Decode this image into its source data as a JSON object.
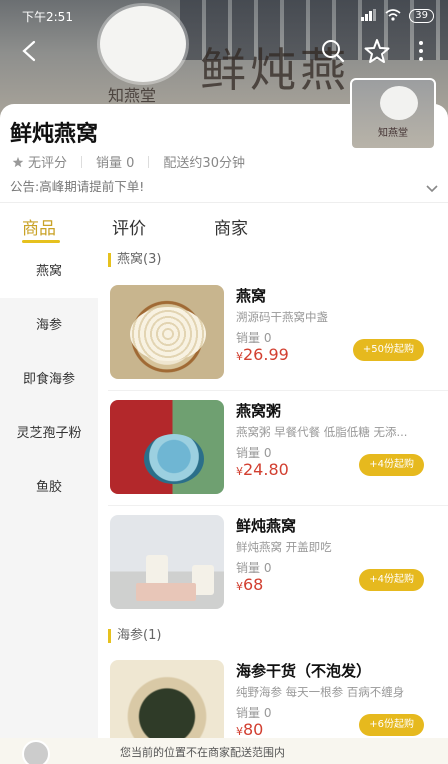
{
  "status_bar": {
    "time": "下午2:51",
    "battery": "39"
  },
  "shop": {
    "name": "鲜炖燕窝",
    "sign_text": "鲜炖燕",
    "sign_small": "知燕堂",
    "thumb_text": "知燕堂",
    "rating": "无评分",
    "sales": "销量 0",
    "delivery": "配送约30分钟",
    "notice": "公告:高峰期请提前下单!"
  },
  "tabs": [
    {
      "label": "商品",
      "active": true
    },
    {
      "label": "评价",
      "active": false
    },
    {
      "label": "商家",
      "active": false
    }
  ],
  "sidebar": [
    {
      "label": "燕窝",
      "active": true
    },
    {
      "label": "海参",
      "active": false
    },
    {
      "label": "即食海参",
      "active": false
    },
    {
      "label": "灵芝孢子粉",
      "active": false
    },
    {
      "label": "鱼胶",
      "active": false
    }
  ],
  "sections": [
    {
      "title": "燕窝(3)",
      "items": [
        {
          "name": "燕窝",
          "desc": "溯源码干燕窝中盏",
          "sales": "销量 0",
          "price": "26.99",
          "button": "+50份起购"
        },
        {
          "name": "燕窝粥",
          "desc": "燕窝粥 早餐代餐 低脂低糖 无添...",
          "sales": "销量 0",
          "price": "24.80",
          "button": "+4份起购"
        },
        {
          "name": "鲜炖燕窝",
          "desc": "鲜炖燕窝 开盖即吃",
          "sales": "销量 0",
          "price": "68",
          "button": "+4份起购"
        }
      ]
    },
    {
      "title": "海参(1)",
      "items": [
        {
          "name": "海参干货（不泡发）",
          "desc": "纯野海参 每天一根参 百病不缠身",
          "sales": "销量 0",
          "price": "80",
          "button": "+6份起购"
        }
      ]
    }
  ],
  "currency": "¥",
  "bottom_tip": "您当前的位置不在商家配送范围内",
  "colors": {
    "accent": "#e6b91e",
    "price": "#d23f30"
  }
}
